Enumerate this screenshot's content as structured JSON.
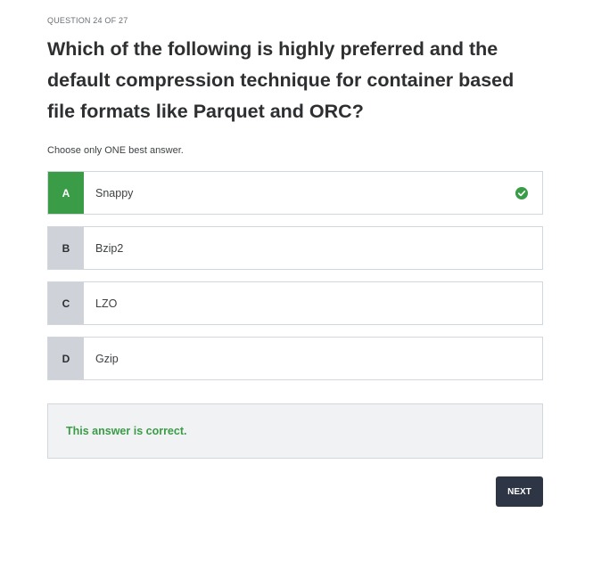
{
  "header": {
    "counter": "QUESTION 24 OF 27"
  },
  "question": {
    "text": "Which of the following is highly preferred and the default compression technique for container based file formats like Parquet and ORC?",
    "instruction": "Choose only ONE best answer."
  },
  "options": [
    {
      "letter": "A",
      "text": "Snappy",
      "state": "correct",
      "icon": "check-circle-icon"
    },
    {
      "letter": "B",
      "text": "Bzip2",
      "state": "unselected"
    },
    {
      "letter": "C",
      "text": "LZO",
      "state": "unselected"
    },
    {
      "letter": "D",
      "text": "Gzip",
      "state": "unselected"
    }
  ],
  "feedback": {
    "message": "This answer is correct."
  },
  "actions": {
    "next_label": "NEXT"
  },
  "colors": {
    "correct_green": "#3a9c47",
    "letter_gray": "#cfd2d9",
    "button_dark": "#2e3545",
    "feedback_bg": "#f1f2f3"
  }
}
